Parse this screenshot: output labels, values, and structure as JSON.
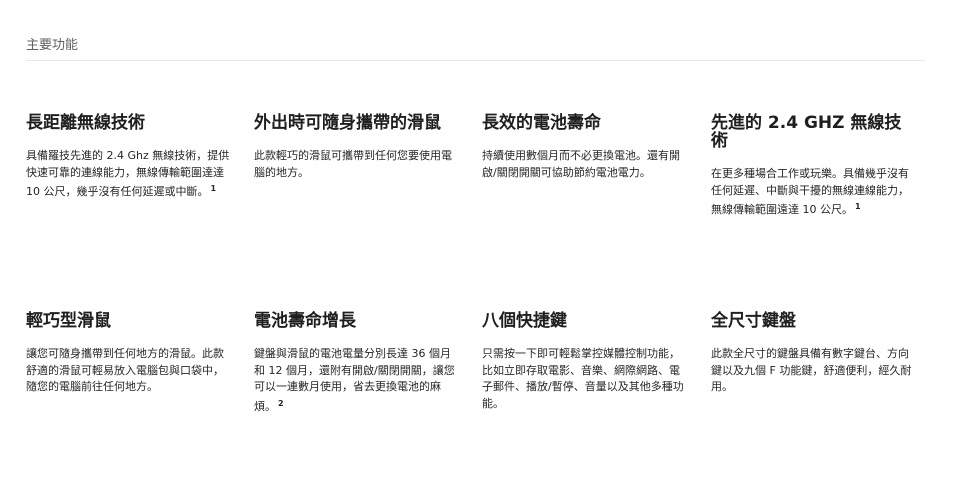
{
  "section": {
    "title": "主要功能"
  },
  "features": [
    {
      "title": "長距離無線技術",
      "desc": "具備羅技先進的 2.4 Ghz 無線技術，提供快速可靠的連線能力，無線傳輸範圍達達 10 公尺，幾乎沒有任何延遲或中斷。",
      "footnote": "1"
    },
    {
      "title": "外出時可隨身攜帶的滑鼠",
      "desc": "此款輕巧的滑鼠可攜帶到任何您要使用電腦的地方。",
      "footnote": ""
    },
    {
      "title": "長效的電池壽命",
      "desc": "持續使用數個月而不必更換電池。還有開啟/關閉開關可協助節約電池電力。",
      "footnote": ""
    },
    {
      "title": "先進的 2.4 GHZ 無線技術",
      "desc": "在更多種場合工作或玩樂。具備幾乎沒有任何延遲、中斷與干擾的無線連線能力，無線傳輸範圍遠達 10 公尺。",
      "footnote": "1"
    },
    {
      "title": "輕巧型滑鼠",
      "desc": "讓您可隨身攜帶到任何地方的滑鼠。此款舒適的滑鼠可輕易放入電腦包與口袋中，隨您的電腦前往任何地方。",
      "footnote": ""
    },
    {
      "title": "電池壽命增長",
      "desc": "鍵盤與滑鼠的電池電量分別長達 36 個月和 12 個月，還附有開啟/關閉開關，讓您可以一連數月使用，省去更換電池的麻煩。",
      "footnote": "2"
    },
    {
      "title": "八個快捷鍵",
      "desc": "只需按一下即可輕鬆掌控媒體控制功能，比如立即存取電影、音樂、網際網路、電子郵件、播放/暫停、音量以及其他多種功能。",
      "footnote": ""
    },
    {
      "title": "全尺寸鍵盤",
      "desc": "此款全尺寸的鍵盤具備有數字鍵台、方向鍵以及九個 F 功能鍵，舒適便利，經久耐用。",
      "footnote": ""
    }
  ]
}
